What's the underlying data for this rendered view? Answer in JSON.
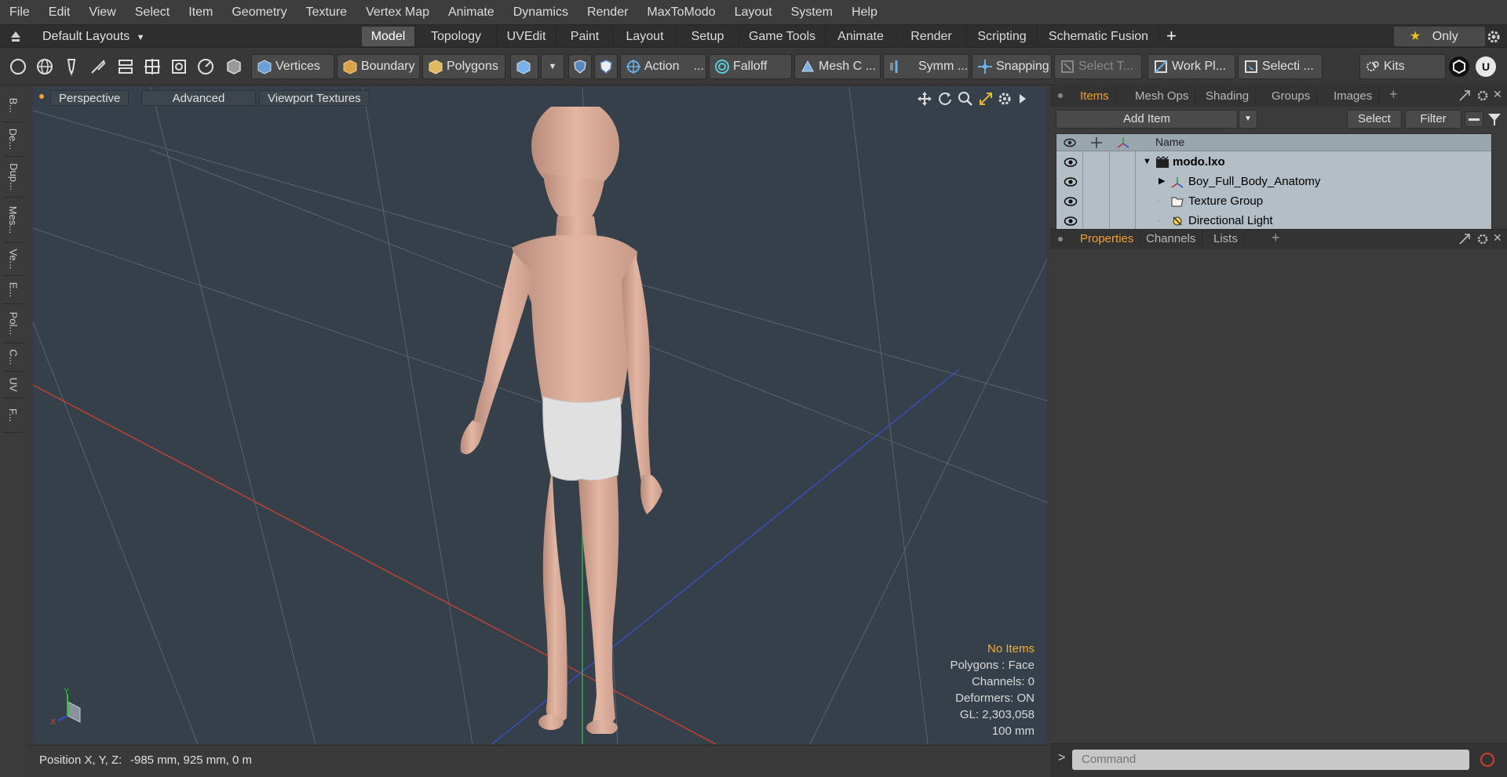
{
  "menubar": {
    "items": [
      "File",
      "Edit",
      "View",
      "Select",
      "Item",
      "Geometry",
      "Texture",
      "Vertex Map",
      "Animate",
      "Dynamics",
      "Render",
      "MaxToModo",
      "Layout",
      "System",
      "Help"
    ]
  },
  "layoutbar": {
    "layout_selector": "Default Layouts",
    "tabs": [
      "Model",
      "Topology",
      "UVEdit",
      "Paint",
      "Layout",
      "Setup",
      "Game Tools",
      "Animate",
      "Render",
      "Scripting",
      "Schematic Fusion"
    ],
    "active_tab": "Model",
    "add_label": "+",
    "only_label": "Only"
  },
  "toolbar": {
    "vertices": "Vertices",
    "boundary": "Boundary",
    "polygons": "Polygons",
    "action": "Action",
    "action_more": "...",
    "falloff": "Falloff",
    "mesh_c": "Mesh C ...",
    "symm": "Symm ...",
    "snapping": "Snapping",
    "select_t": "Select T...",
    "work_pl": "Work Pl...",
    "selecti": "Selecti ...",
    "kits": "Kits"
  },
  "left_tabs": [
    "B...",
    "De...",
    "Dup...",
    "Mes...",
    "Ve...",
    "E...",
    "Pol...",
    "C...",
    "UV",
    "F..."
  ],
  "viewport": {
    "tabs": [
      "Perspective",
      "Advanced",
      "Viewport Textures"
    ],
    "info": {
      "no_items": "No Items",
      "polygons": "Polygons : Face",
      "channels": "Channels: 0",
      "deformers": "Deformers: ON",
      "gl": "GL: 2,303,058",
      "scale": "100 mm"
    },
    "axis_x": "X",
    "axis_y": "Y",
    "colors": {
      "background": "#36404a",
      "x_axis": "#d04030",
      "y_axis": "#30c040",
      "z_axis": "#3a50d0"
    }
  },
  "statusbar": {
    "position_label": "Position X, Y, Z:",
    "position_value": "-985 mm, 925 mm, 0 m"
  },
  "items_panel": {
    "tabs": [
      "Items",
      "Mesh Ops",
      "Shading",
      "Groups",
      "Images"
    ],
    "active_tab": "Items",
    "add_item": "Add Item",
    "select": "Select",
    "filter": "Filter",
    "name_header": "Name",
    "rows": [
      {
        "label": "modo.lxo",
        "icon": "scene-icon"
      },
      {
        "label": "Boy_Full_Body_Anatomy",
        "icon": "mesh-icon"
      },
      {
        "label": "Texture Group",
        "icon": "folder-icon"
      },
      {
        "label": "Directional Light",
        "icon": "light-icon"
      }
    ]
  },
  "properties_panel": {
    "tabs": [
      "Properties",
      "Channels",
      "Lists"
    ],
    "active_tab": "Properties"
  },
  "command": {
    "prompt": ">",
    "placeholder": "Command"
  }
}
